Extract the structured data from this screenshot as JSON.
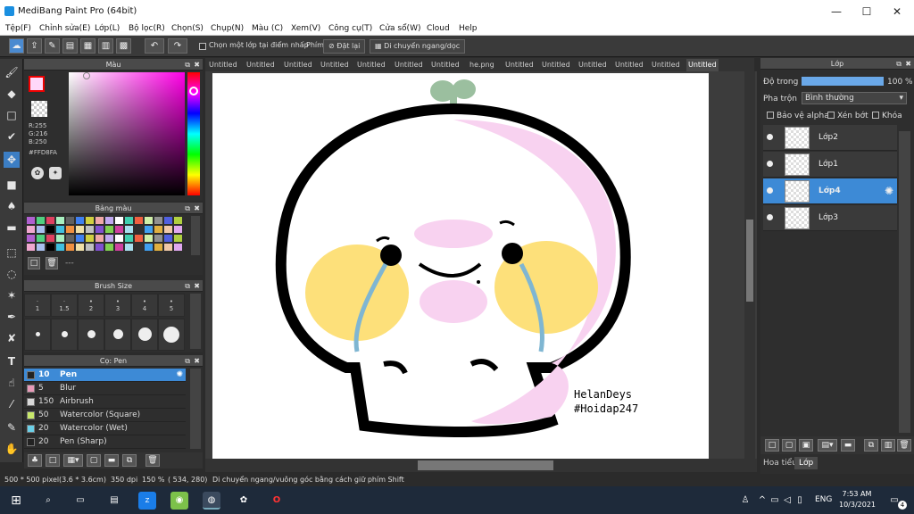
{
  "window": {
    "title": "MediBang Paint Pro (64bit)"
  },
  "menu": [
    "Tệp(F)",
    "Chỉnh sửa(E)",
    "Lớp(L)",
    "Bộ lọc(R)",
    "Chọn(S)",
    "Chụp(N)",
    "Màu (C)",
    "Xem(V)",
    "Công cụ(T)",
    "Cửa sổ(W)",
    "Cloud",
    "Help"
  ],
  "toolbar": {
    "snap_label": "Chọn một lớp tại điểm nhấp",
    "phim_label": "Phím",
    "reset_label": "Đặt lại",
    "move_label": "Di chuyển ngang/dọc"
  },
  "color_panel": {
    "title": "Màu",
    "r": "R:255",
    "g": "G:216",
    "b": "B:250",
    "hex": "#FFD8FA"
  },
  "palette_panel": {
    "title": "Bảng màu",
    "dots": "---"
  },
  "brush_size_panel": {
    "title": "Brush Size",
    "sizes": [
      "1",
      "1.5",
      "2",
      "3",
      "4",
      "5"
    ]
  },
  "brush_panel": {
    "title": "Cọ: Pen",
    "items": [
      {
        "size": "10",
        "name": "Pen",
        "color": "#222222",
        "selected": true
      },
      {
        "size": "5",
        "name": "Blur",
        "color": "#e89ab8",
        "selected": false
      },
      {
        "size": "150",
        "name": "Airbrush",
        "color": "#d8d8d8",
        "selected": false
      },
      {
        "size": "50",
        "name": "Watercolor (Square)",
        "color": "#c8e86a",
        "selected": false
      },
      {
        "size": "20",
        "name": "Watercolor (Wet)",
        "color": "#6ad0e8",
        "selected": false
      },
      {
        "size": "20",
        "name": "Pen (Sharp)",
        "color": "#222222",
        "selected": false
      }
    ]
  },
  "tabs": [
    "Untitled",
    "Untitled",
    "Untitled",
    "Untitled",
    "Untitled",
    "Untitled",
    "Untitled",
    "he.png",
    "Untitled",
    "Untitled",
    "Untitled",
    "Untitled",
    "Untitled",
    "Untitled"
  ],
  "canvas": {
    "text1": "HelanDeys",
    "text2": "#Hoidap247"
  },
  "layer_panel": {
    "title": "Lớp",
    "opacity_label": "Độ trong",
    "opacity_value": "100 %",
    "blend_label": "Pha trộn",
    "blend_value": "Bình thường",
    "protect_alpha": "Bảo vệ alpha",
    "clip": "Xén bớt",
    "lock": "Khóa",
    "layers": [
      {
        "name": "Lớp2",
        "selected": false
      },
      {
        "name": "Lớp1",
        "selected": false
      },
      {
        "name": "Lớp4",
        "selected": true
      },
      {
        "name": "Lớp3",
        "selected": false
      }
    ],
    "tab_hoa": "Hoa tiểu",
    "tab_lop": "Lớp"
  },
  "status": {
    "size": "500 * 500 pixel",
    "cm": "(3.6 * 3.6cm)",
    "dpi": "350 dpi",
    "zoom": "150 %",
    "coords": "( 534, 280)",
    "hint": "Di chuyển ngang/vuông góc bằng cách giữ phím Shift"
  },
  "taskbar": {
    "lang": "ENG",
    "time": "7:53 AM",
    "date": "10/3/2021",
    "badge": "4"
  }
}
